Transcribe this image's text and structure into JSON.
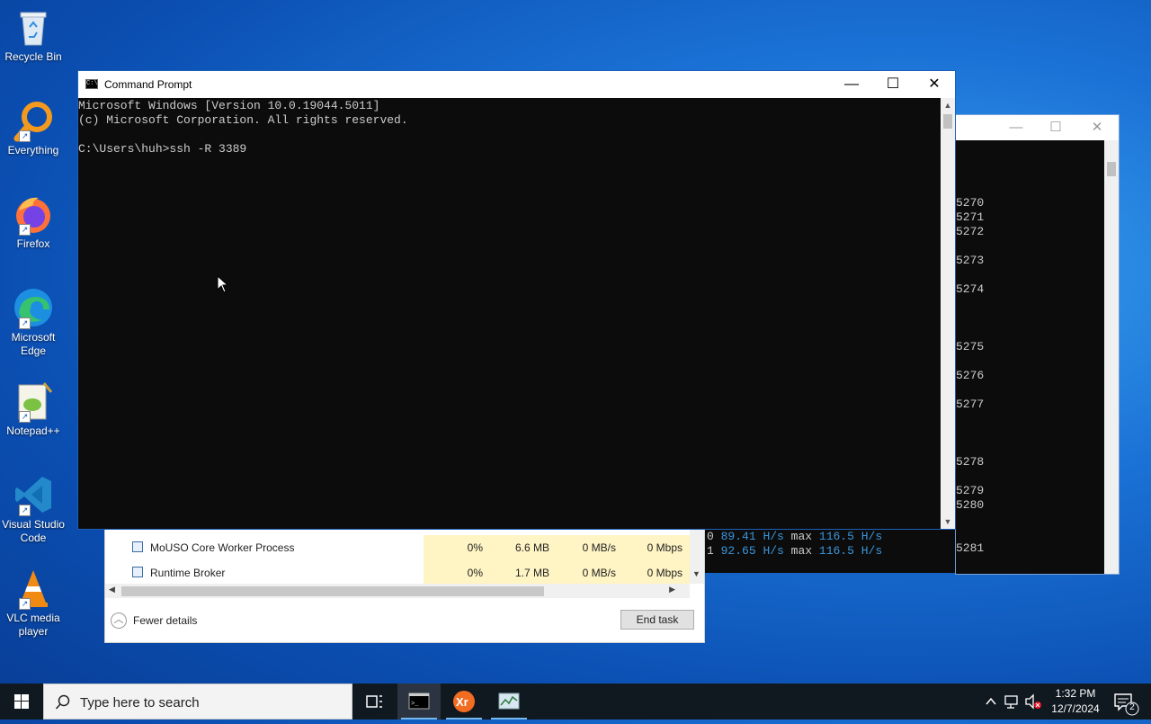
{
  "desktop_icons": [
    {
      "label": "Recycle Bin"
    },
    {
      "label": "Everything"
    },
    {
      "label": "Firefox"
    },
    {
      "label": "Microsoft Edge"
    },
    {
      "label": "Notepad++"
    },
    {
      "label": "Visual Studio Code"
    },
    {
      "label": "VLC media player"
    }
  ],
  "cmd_window": {
    "title": "Command Prompt",
    "lines": [
      "Microsoft Windows [Version 10.0.19044.5011]",
      "(c) Microsoft Corporation. All rights reserved.",
      "",
      "C:\\Users\\huh>ssh -R 3389"
    ]
  },
  "bg_console": {
    "numbers": [
      "5270",
      "5271",
      "5272",
      "5273",
      "5274",
      "5275",
      "5276",
      "5277",
      "5278",
      "5279",
      "5280",
      "5281"
    ],
    "hash_lines": [
      {
        "prefix": "0",
        "rate": "89.41",
        "unit": "H/s",
        "max_label": "max",
        "max": "116.5",
        "max_unit": "H/s"
      },
      {
        "prefix": "1",
        "rate": "92.65",
        "unit": "H/s",
        "max_label": "max",
        "max": "116.5",
        "max_unit": "H/s"
      }
    ]
  },
  "task_manager": {
    "rows": [
      {
        "name": "MoUSO Core Worker Process",
        "cpu": "0%",
        "memory": "6.6 MB",
        "disk": "0 MB/s",
        "network": "0 Mbps"
      },
      {
        "name": "Runtime Broker",
        "cpu": "0%",
        "memory": "1.7 MB",
        "disk": "0 MB/s",
        "network": "0 Mbps"
      }
    ],
    "fewer_details": "Fewer details",
    "end_task": "End task"
  },
  "taskbar": {
    "search_placeholder": "Type here to search",
    "time": "1:32 PM",
    "date": "12/7/2024",
    "notification_count": "2"
  },
  "colors": {
    "console_bg": "#0c0c0c",
    "console_text": "#cccccc",
    "hash_accent": "#3a96dd",
    "highlight_cell": "#fff4c4"
  }
}
